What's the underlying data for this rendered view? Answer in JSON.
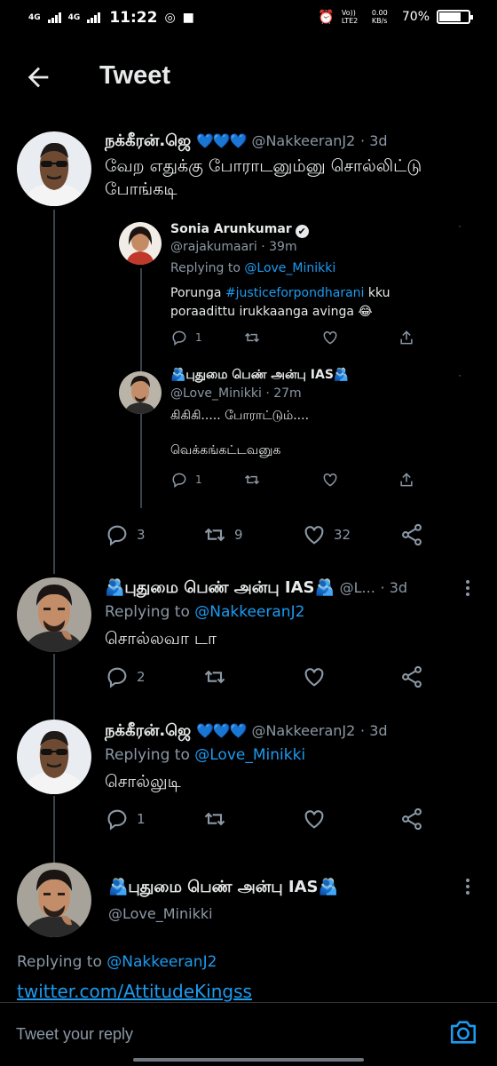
{
  "status_bar": {
    "network1": "4G",
    "network2": "4G",
    "time": "11:22",
    "volte": "Vo)) LTE2",
    "speed": "0.00 KB/s",
    "battery": "70%",
    "battery_level": 0.7
  },
  "header": {
    "title": "Tweet"
  },
  "tweets": [
    {
      "name": "நக்கீரன்.ஜெ",
      "hearts": "💙💙💙",
      "handle": "@NakkeeranJ2",
      "time": "· 3d",
      "text_line1": "வேற எதுக்கு போராடனும்னு சொல்லிட்டு",
      "text_line2": "போங்கடி",
      "reply_count": "3",
      "retweet_count": "9",
      "like_count": "32"
    },
    {
      "name": "🫂புதுமை பெண் அன்பு IAS🫂",
      "handle": "@L...",
      "time": "· 3d",
      "replying_prefix": "Replying to",
      "replying_to": "@NakkeeranJ2",
      "text": "சொல்லவா டா",
      "reply_count": "2"
    },
    {
      "name": "நக்கீரன்.ஜெ",
      "hearts": "💙💙💙",
      "handle": "@NakkeeranJ2",
      "time": "· 3d",
      "replying_prefix": "Replying to",
      "replying_to": "@Love_Minikki",
      "text": "சொல்லுடி",
      "reply_count": "1"
    },
    {
      "name": "🫂புதுமை பெண் அன்பு IAS🫂",
      "handle": "@Love_Minikki",
      "replying_prefix": "Replying to",
      "replying_to": "@NakkeeranJ2",
      "link_text": "twitter.com/AttitudeKingss"
    }
  ],
  "quoted": [
    {
      "name": "Sonia Arunkumar",
      "verified_mark": "✔",
      "handle": "@rajakumaari",
      "time": "· 39m",
      "replying_prefix": "Replying to",
      "replying_to": "@Love_Minikki",
      "text_pre": "Porunga",
      "hashtag": "#justiceforpondharani",
      "text_post": "kku",
      "text_line2": "poraadittu irukkaanga avinga 😂",
      "reply_count": "1"
    },
    {
      "name": "🫂புதுமை பெண் அன்பு IAS🫂",
      "handle": "@Love_Minikki",
      "time": "· 27m",
      "text_line1": "கிகிகி..... போராட்டும்....",
      "text_line2": "வெக்கங்கட்டவனுக",
      "reply_count": "1"
    }
  ],
  "reply_bar": {
    "placeholder": "Tweet your reply"
  },
  "colors": {
    "accent": "#1d9bf0",
    "background": "#000000",
    "muted": "#8b98a5"
  }
}
